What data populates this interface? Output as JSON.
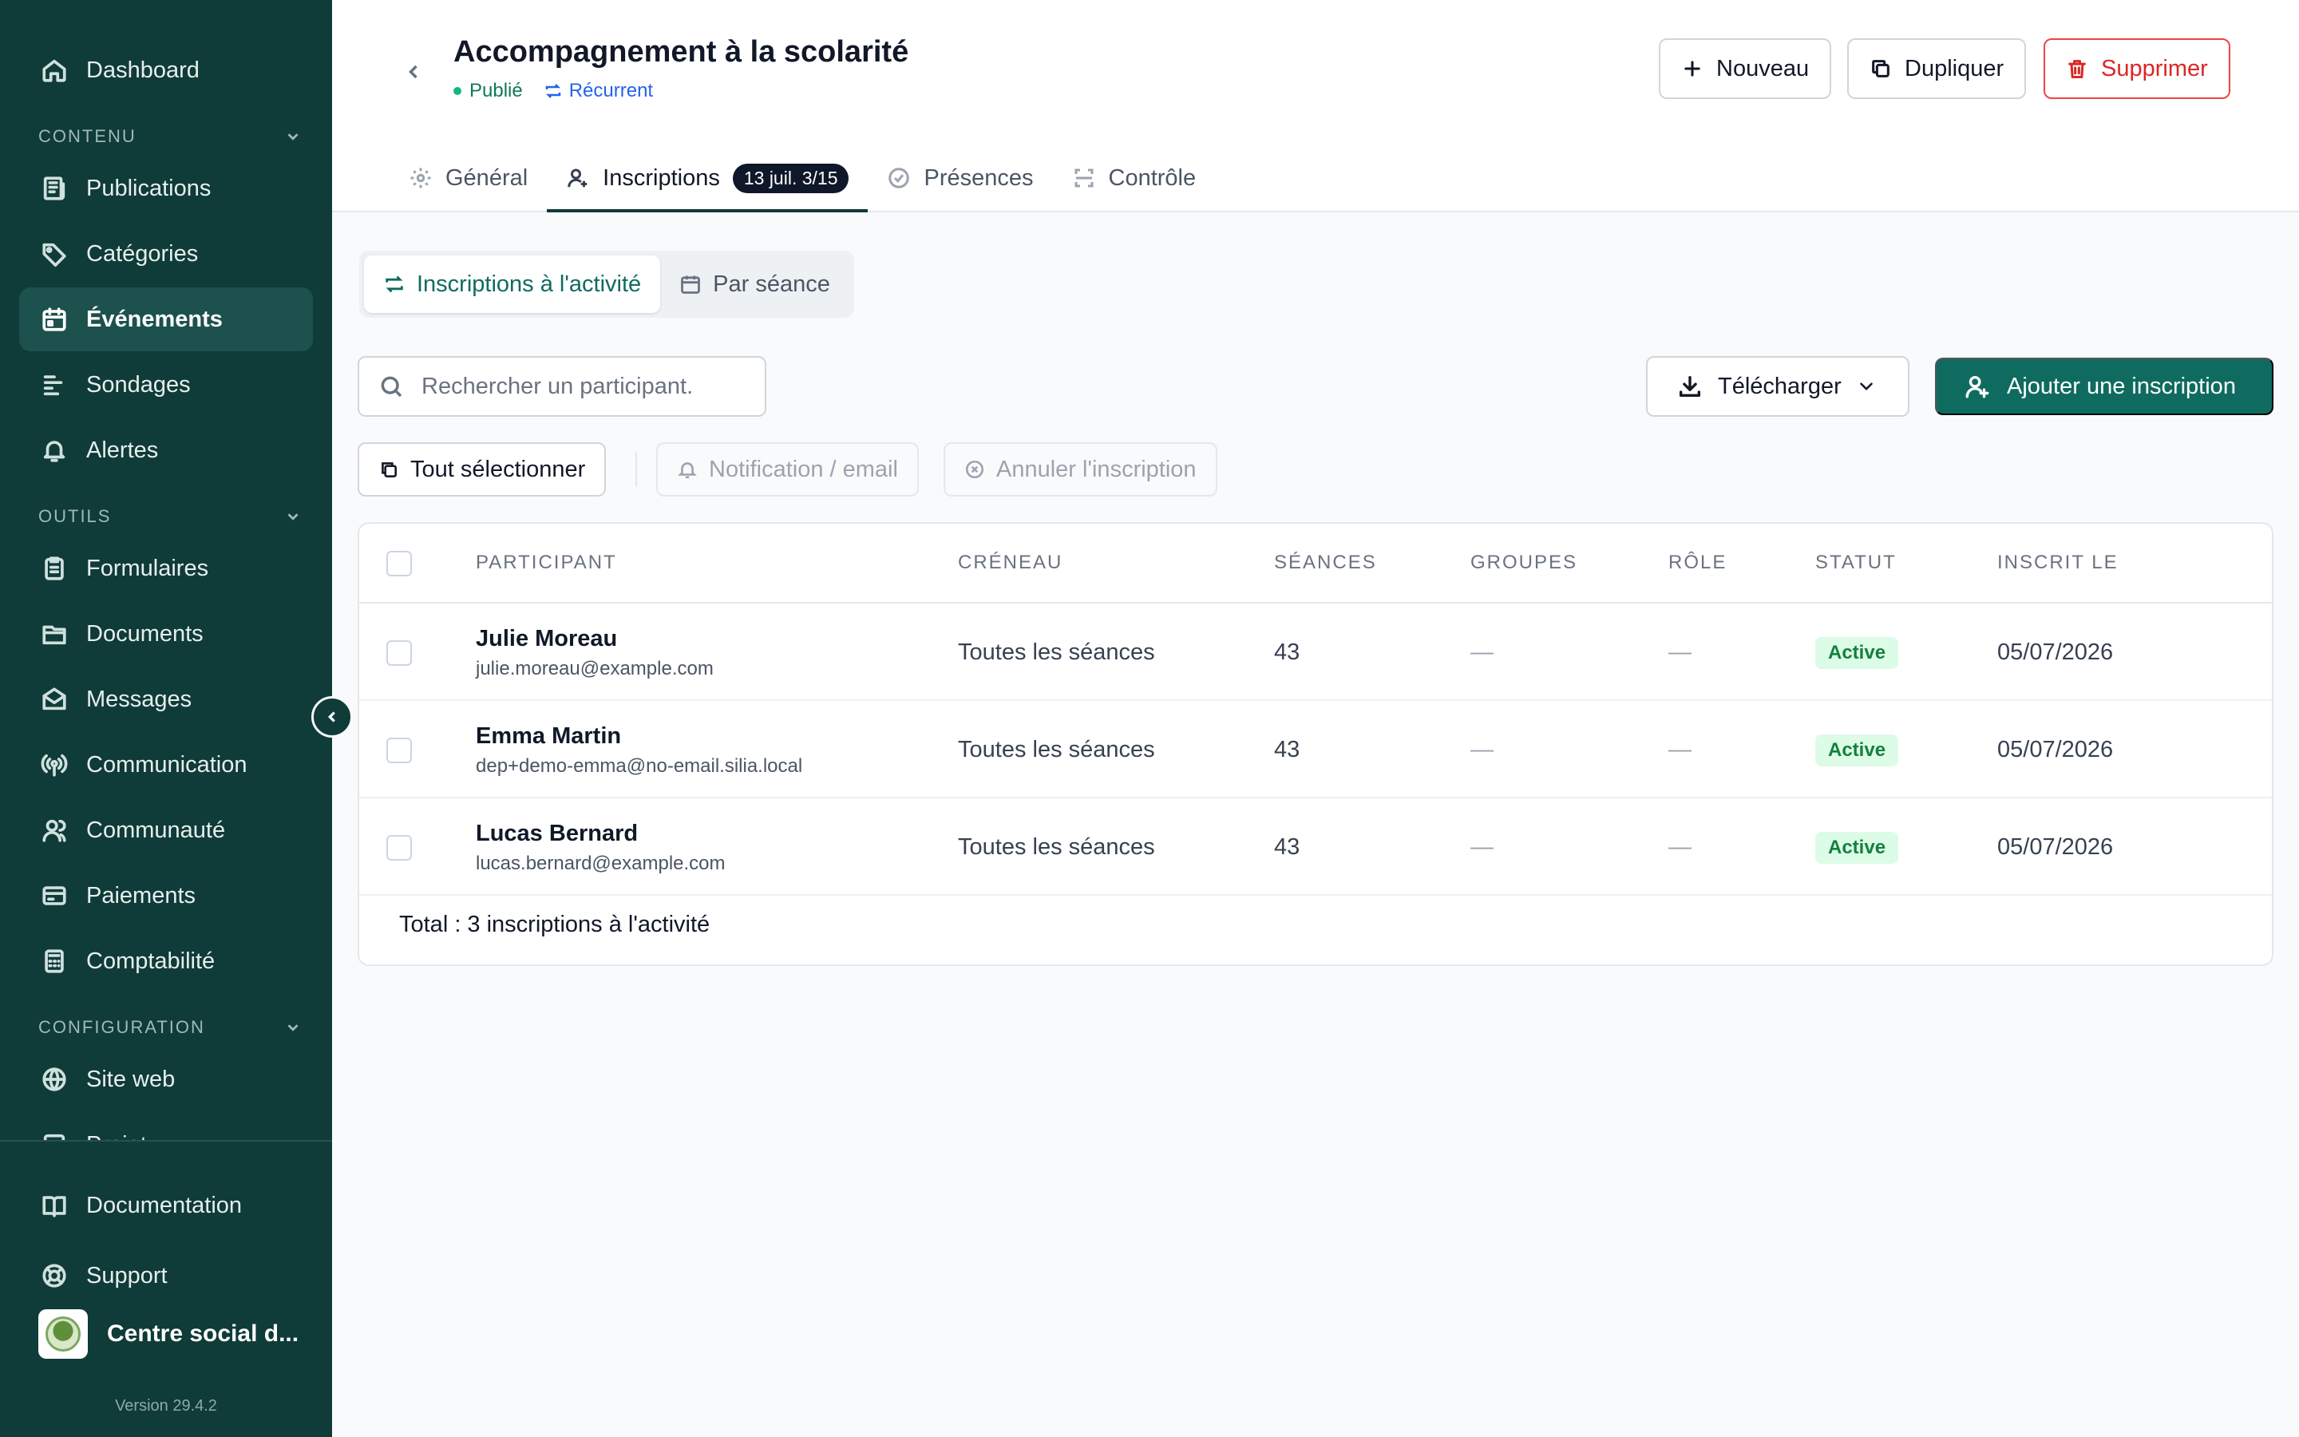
{
  "sidebar": {
    "sections": {
      "content": "CONTENU",
      "tools": "OUTILS",
      "config": "CONFIGURATION"
    },
    "items": [
      {
        "label": "Dashboard",
        "icon": "home-icon"
      },
      {
        "label": "Publications",
        "icon": "newspaper-icon"
      },
      {
        "label": "Catégories",
        "icon": "tag-icon"
      },
      {
        "label": "Événements",
        "icon": "calendar-icon",
        "active": true
      },
      {
        "label": "Sondages",
        "icon": "bars-icon"
      },
      {
        "label": "Alertes",
        "icon": "bell-icon"
      },
      {
        "label": "Formulaires",
        "icon": "clipboard-icon"
      },
      {
        "label": "Documents",
        "icon": "folder-icon"
      },
      {
        "label": "Messages",
        "icon": "mail-icon"
      },
      {
        "label": "Communication",
        "icon": "broadcast-icon"
      },
      {
        "label": "Communauté",
        "icon": "users-icon"
      },
      {
        "label": "Paiements",
        "icon": "card-icon"
      },
      {
        "label": "Comptabilité",
        "icon": "calculator-icon"
      },
      {
        "label": "Site web",
        "icon": "globe-icon"
      },
      {
        "label": "Projet",
        "icon": "project-icon"
      }
    ],
    "footer": {
      "documentation": "Documentation",
      "support": "Support",
      "org_name": "Centre social d...",
      "version": "Version 29.4.2"
    }
  },
  "header": {
    "title": "Accompagnement à la scolarité",
    "status_published": "Publié",
    "status_recurrent": "Récurrent",
    "buttons": {
      "new": "Nouveau",
      "duplicate": "Dupliquer",
      "delete": "Supprimer"
    },
    "tabs": [
      {
        "label": "Général"
      },
      {
        "label": "Inscriptions",
        "badge": "13 juil. 3/15"
      },
      {
        "label": "Présences"
      },
      {
        "label": "Contrôle"
      }
    ]
  },
  "main": {
    "segment": {
      "activity": "Inscriptions à l'activité",
      "session": "Par séance"
    },
    "search_placeholder": "Rechercher un participant.",
    "download": "Télécharger",
    "add": "Ajouter une inscription",
    "actions": {
      "select_all": "Tout sélectionner",
      "notify": "Notification / email",
      "cancel": "Annuler l'inscription"
    },
    "table": {
      "columns": [
        "PARTICIPANT",
        "CRÉNEAU",
        "SÉANCES",
        "GROUPES",
        "RÔLE",
        "STATUT",
        "INSCRIT LE"
      ],
      "rows": [
        {
          "name": "Julie Moreau",
          "email": "julie.moreau@example.com",
          "slot": "Toutes les séances",
          "sessions": "43",
          "groups": "—",
          "role": "—",
          "status": "Active",
          "date": "05/07/2026"
        },
        {
          "name": "Emma Martin",
          "email": "dep+demo-emma@no-email.silia.local",
          "slot": "Toutes les séances",
          "sessions": "43",
          "groups": "—",
          "role": "—",
          "status": "Active",
          "date": "05/07/2026"
        },
        {
          "name": "Lucas Bernard",
          "email": "lucas.bernard@example.com",
          "slot": "Toutes les séances",
          "sessions": "43",
          "groups": "—",
          "role": "—",
          "status": "Active",
          "date": "05/07/2026"
        }
      ],
      "total": "Total : 3 inscriptions à l'activité"
    }
  },
  "colors": {
    "sidebar_bg": "#0f3b38",
    "primary": "#0f6b60",
    "danger": "#dc2626",
    "active_badge_bg": "#dcfce7",
    "active_badge_text": "#15803d"
  }
}
